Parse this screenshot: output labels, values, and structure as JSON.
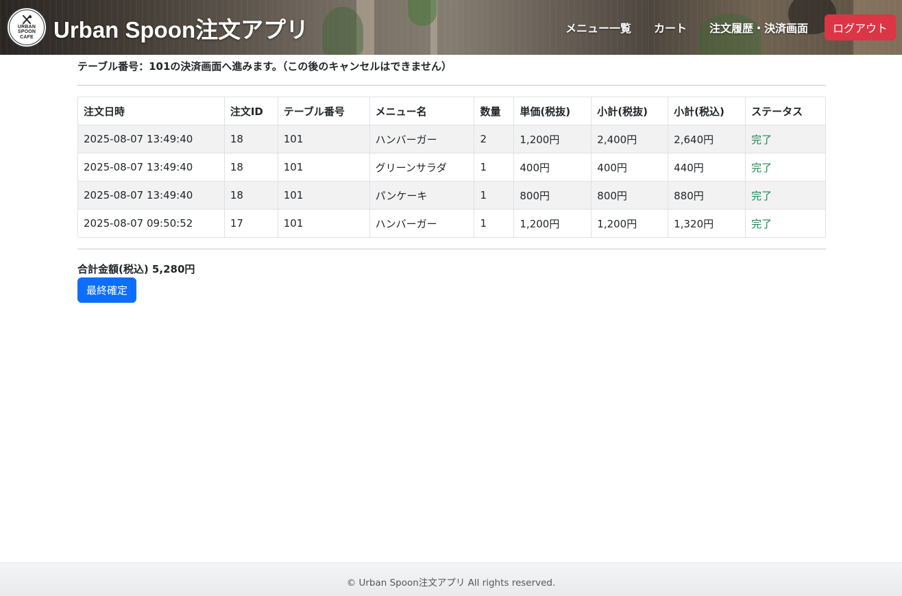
{
  "header": {
    "logo_lines": [
      "URBAN",
      "SPOON",
      "CAFE"
    ],
    "title": "Urban Spoon注文アプリ",
    "nav": [
      "メニュー一覧",
      "カート",
      "注文履歴・決済画面"
    ],
    "logout_label": "ログアウト"
  },
  "main": {
    "notice": "テーブル番号：101の決済画面へ進みます。（この後のキャンセルはできません）",
    "table": {
      "columns": [
        "注文日時",
        "注文ID",
        "テーブル番号",
        "メニュー名",
        "数量",
        "単価(税抜)",
        "小計(税抜)",
        "小計(税込)",
        "ステータス"
      ],
      "rows": [
        [
          "2025-08-07 13:49:40",
          "18",
          "101",
          "ハンバーガー",
          "2",
          "1,200円",
          "2,400円",
          "2,640円",
          "完了"
        ],
        [
          "2025-08-07 13:49:40",
          "18",
          "101",
          "グリーンサラダ",
          "1",
          "400円",
          "400円",
          "440円",
          "完了"
        ],
        [
          "2025-08-07 13:49:40",
          "18",
          "101",
          "パンケーキ",
          "1",
          "800円",
          "800円",
          "880円",
          "完了"
        ],
        [
          "2025-08-07 09:50:52",
          "17",
          "101",
          "ハンバーガー",
          "1",
          "1,200円",
          "1,200円",
          "1,320円",
          "完了"
        ]
      ]
    },
    "total_label": "合計金額(税込) 5,280円",
    "confirm_label": "最終確定"
  },
  "footer": {
    "copyright": "© Urban Spoon注文アプリ All rights reserved."
  },
  "colors": {
    "logout": "#dc3545",
    "primary": "#0d6efd",
    "status_complete": "#198754",
    "striped_row": "#f2f2f2"
  }
}
